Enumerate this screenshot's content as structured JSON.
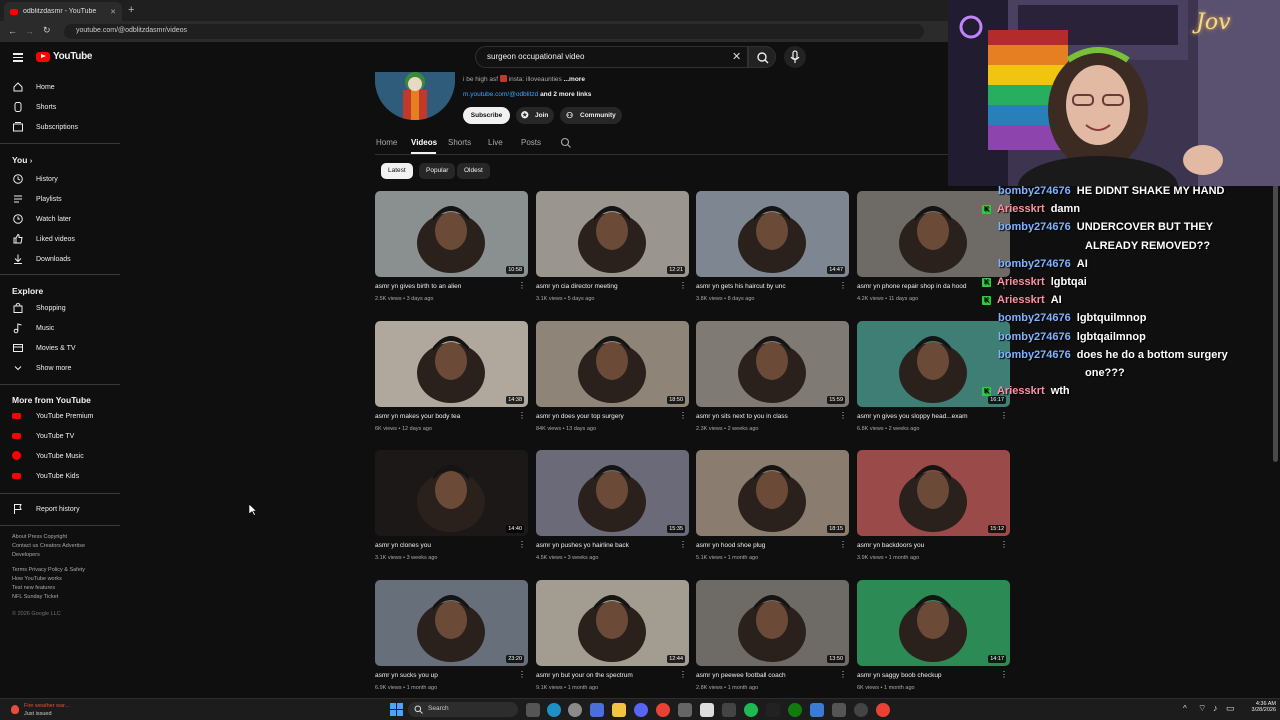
{
  "browser": {
    "tab_title": "odblitzdasmr - YouTube",
    "tab_close": "✕",
    "new_tab": "+",
    "address": "youtube.com/@odblitzdasmr/videos"
  },
  "youtube": {
    "logo_text": "YouTube",
    "search": {
      "query": "surgeon occupational video"
    },
    "channel": {
      "bio": "i be high asf",
      "bio_insta": "insta: illoveaunties",
      "more": "...more",
      "link": "m.youtube.com/@odblitzd",
      "more_links": "and 2 more links",
      "subscribe": "Subscribe",
      "join": "Join",
      "community": "Community"
    },
    "channel_tabs": [
      "Home",
      "Videos",
      "Shorts",
      "Live",
      "Posts"
    ],
    "chips": [
      "Latest",
      "Popular",
      "Oldest"
    ],
    "sidebar": {
      "main": [
        "Home",
        "Shorts",
        "Subscriptions"
      ],
      "you_header": "You",
      "you": [
        "History",
        "Playlists",
        "Watch later",
        "Liked videos",
        "Downloads"
      ],
      "explore_header": "Explore",
      "explore": [
        "Shopping",
        "Music",
        "Movies & TV",
        "Show more"
      ],
      "more_header": "More from YouTube",
      "more": [
        "YouTube Premium",
        "YouTube TV",
        "YouTube Music",
        "YouTube Kids"
      ],
      "report": "Report history",
      "footer1": "About  Press  Copyright",
      "footer2": "Contact us  Creators  Advertise",
      "footer3": "Developers",
      "footer4": "Terms  Privacy  Policy & Safety",
      "footer5": "How YouTube works",
      "footer6": "Test new features",
      "footer7": "NFL Sunday Ticket",
      "copyright": "© 2026 Google LLC"
    },
    "videos": [
      {
        "title": "asmr yn gives birth to an alien",
        "meta": "2.5K views • 3 days ago",
        "duration": "10:58",
        "color": "#8a8f8f"
      },
      {
        "title": "asmr yn cia director meeting",
        "meta": "3.1K views • 5 days ago",
        "duration": "12:21",
        "color": "#9a968f"
      },
      {
        "title": "asmr yn gets his haircut by unc",
        "meta": "3.8K views • 8 days ago",
        "duration": "14:47",
        "color": "#7e8791"
      },
      {
        "title": "asmr yn phone repair shop in da hood",
        "meta": "4.2K views • 11 days ago",
        "duration": "",
        "color": "#6e6a66"
      },
      {
        "title": "asmr yn makes your body tea",
        "meta": "6K views • 12 days ago",
        "duration": "14:38",
        "color": "#b0a89c"
      },
      {
        "title": "asmr yn does your top surgery",
        "meta": "84K views • 13 days ago",
        "duration": "18:50",
        "color": "#8e8478"
      },
      {
        "title": "asmr yn sits next to you in class",
        "meta": "2.3K views • 2 weeks ago",
        "duration": "15:59",
        "color": "#7f7a74"
      },
      {
        "title": "asmr yn gives you sloppy head...exam",
        "meta": "6.8K views • 2 weeks ago",
        "duration": "16:17",
        "color": "#3e7e74"
      },
      {
        "title": "asmr yn clones you",
        "meta": "3.1K views • 3 weeks ago",
        "duration": "14:40",
        "color": "#1c1818"
      },
      {
        "title": "asmr yn pushes yo hairline back",
        "meta": "4.5K views • 3 weeks ago",
        "duration": "15:35",
        "color": "#6a6a78"
      },
      {
        "title": "asmr yn hood shoe plug",
        "meta": "5.1K views • 1 month ago",
        "duration": "18:15",
        "color": "#8a7d70"
      },
      {
        "title": "asmr yn backdoors you",
        "meta": "3.9K views • 1 month ago",
        "duration": "15:12",
        "color": "#9b4a4a"
      },
      {
        "title": "asmr yn sucks you up",
        "meta": "6.9K views • 1 month ago",
        "duration": "23:20",
        "color": "#67707a"
      },
      {
        "title": "asmr yn but your on the spectrum",
        "meta": "9.1K views • 1 month ago",
        "duration": "12:44",
        "color": "#a39c90"
      },
      {
        "title": "asmr yn peewee football coach",
        "meta": "2.8K views • 1 month ago",
        "duration": "13:50",
        "color": "#6e6b66"
      },
      {
        "title": "asmr yn saggy boob checkup",
        "meta": "6K views • 1 month ago",
        "duration": "14:17",
        "color": "#2c8a55"
      }
    ]
  },
  "stream_overlay": {
    "chat": [
      {
        "user": "bomby274676",
        "msg": "HE DIDNT SHAKE MY HAND",
        "badge": false,
        "user_color": "#7fb2ff"
      },
      {
        "user": "Ariesskrt",
        "msg": "damn",
        "badge": true,
        "user_color": "#ff8fa3"
      },
      {
        "user": "bomby274676",
        "msg": "UNDERCOVER BUT THEY",
        "badge": false,
        "user_color": "#7fb2ff"
      },
      {
        "user": "",
        "msg": "ALREADY REMOVED??",
        "badge": false,
        "user_color": "#7fb2ff"
      },
      {
        "user": "bomby274676",
        "msg": "AI",
        "badge": false,
        "user_color": "#7fb2ff"
      },
      {
        "user": "Ariesskrt",
        "msg": "lgbtqai",
        "badge": true,
        "user_color": "#ff8fa3"
      },
      {
        "user": "Ariesskrt",
        "msg": "AI",
        "badge": true,
        "user_color": "#ff8fa3"
      },
      {
        "user": "bomby274676",
        "msg": "lgbtquilmnop",
        "badge": false,
        "user_color": "#7fb2ff"
      },
      {
        "user": "bomby274676",
        "msg": "lgbtqailmnop",
        "badge": false,
        "user_color": "#7fb2ff"
      },
      {
        "user": "bomby274676",
        "msg": "does he do a bottom surgery",
        "badge": false,
        "user_color": "#7fb2ff"
      },
      {
        "user": "",
        "msg": "one???",
        "badge": false,
        "user_color": "#7fb2ff"
      },
      {
        "user": "Ariesskrt",
        "msg": "wth",
        "badge": true,
        "user_color": "#ff8fa3"
      }
    ],
    "badge_letter": "K",
    "cam_sign": "Jov"
  },
  "taskbar": {
    "notif_title": "Fire weather war...",
    "notif_sub": "Just issued",
    "search": "Search",
    "time": "4:36 AM",
    "date": "3/28/2026"
  }
}
